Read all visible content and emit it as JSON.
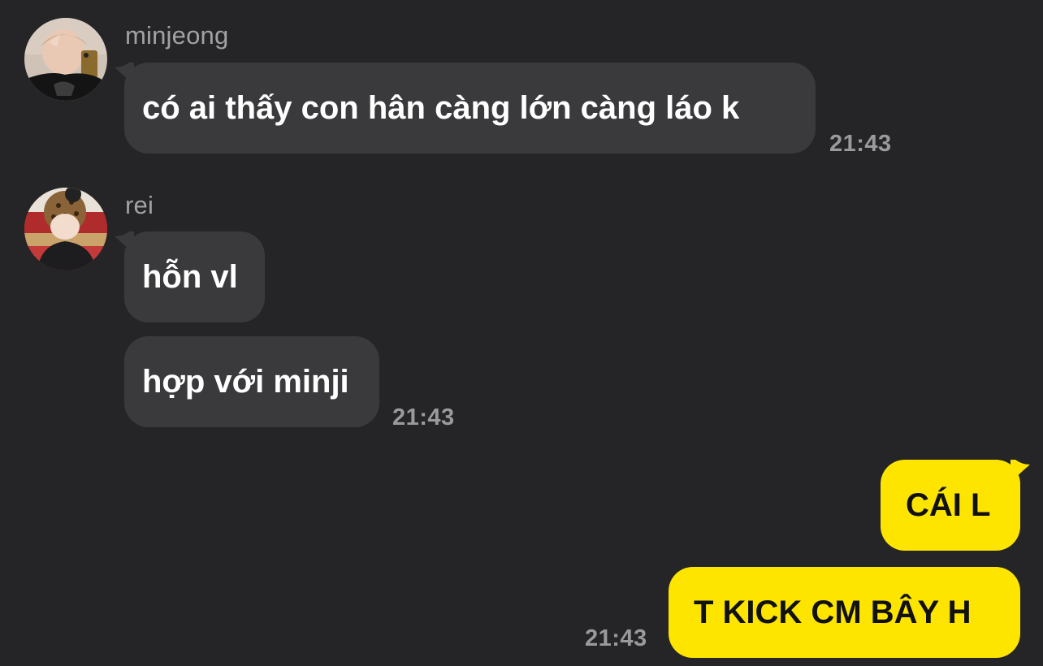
{
  "colors": {
    "background": "#252527",
    "incoming_bubble": "#3a3a3d",
    "outgoing_bubble": "#fee500",
    "name_text": "#a2a2a6",
    "time_text": "#9a9a9e"
  },
  "messages": [
    {
      "sender": "minjeong",
      "avatar_icon": "user-avatar-photo",
      "bubbles": [
        "có ai thấy con hân càng lớn càng láo k"
      ],
      "time": "21:43"
    },
    {
      "sender": "rei",
      "avatar_icon": "user-avatar-photo",
      "bubbles": [
        "hỗn vl",
        "hợp với minji"
      ],
      "time": "21:43"
    },
    {
      "sender": "me",
      "bubbles": [
        "CÁI L",
        "T KICK CM BÂY H"
      ],
      "time": "21:43"
    }
  ]
}
